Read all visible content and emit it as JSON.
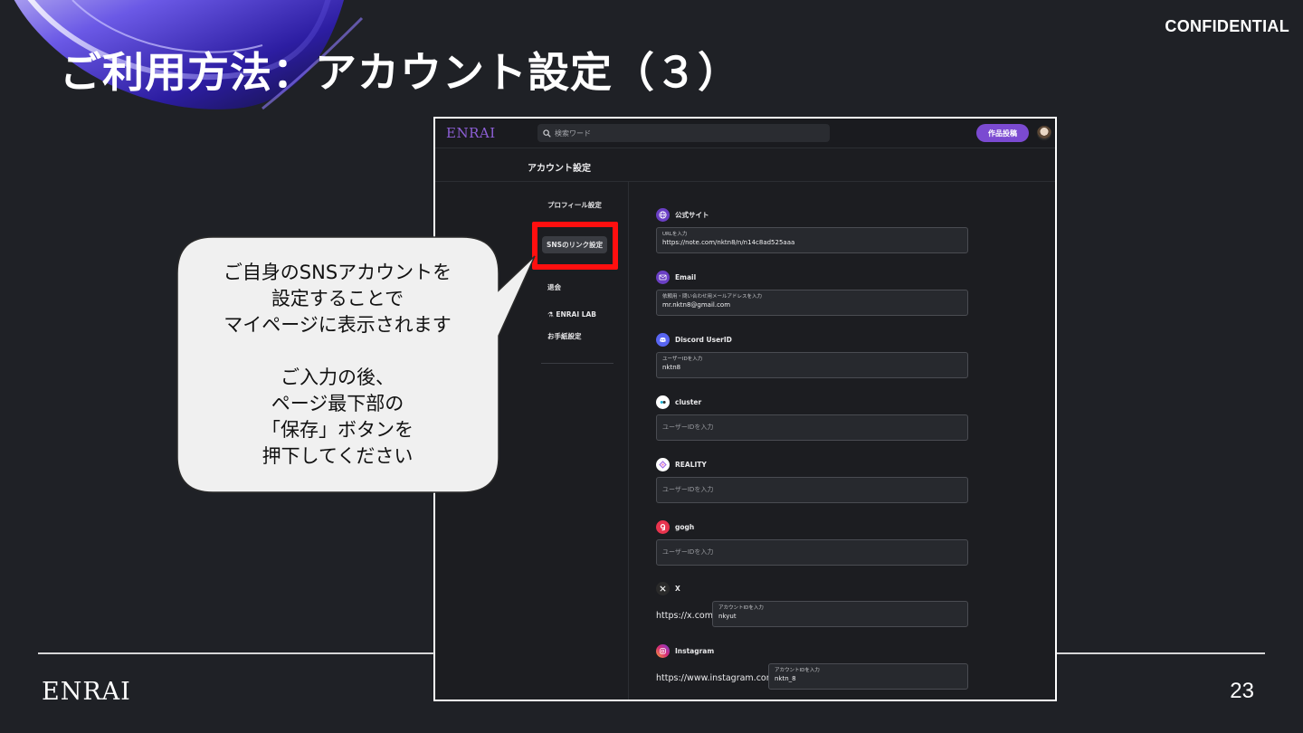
{
  "slide": {
    "confidential": "CONFIDENTIAL",
    "title": "ご利用方法：アカウント設定（３）",
    "footer_logo": "ENRAI",
    "page_number": "23"
  },
  "app": {
    "logo": "ENRAI",
    "search_placeholder": "検索ワード",
    "post_button": "作品投稿",
    "page_title": "アカウント設定",
    "sidebar": {
      "items": [
        "プロフィール設定",
        "SNSのリンク設定",
        "退会",
        "ENRAI LAB",
        "お手紙設定"
      ],
      "active_index": 1
    },
    "sns": [
      {
        "label": "公式サイト",
        "caption": "URLを入力",
        "value": "https://note.com/nktn8/n/n14c8ad525aaa",
        "icon": "globe-icon",
        "color": "#6a3fc4"
      },
      {
        "label": "Email",
        "caption": "依頼用・問い合わせ用メールアドレスを入力",
        "value": "mr.nktn8@gmail.com",
        "icon": "mail-icon",
        "color": "#6a3fc4"
      },
      {
        "label": "Discord UserID",
        "caption": "ユーザーIDを入力",
        "value": "nktn8",
        "icon": "discord-icon",
        "color": "#5865f2"
      },
      {
        "label": "cluster",
        "placeholder": "ユーザーIDを入力",
        "icon": "cluster-icon",
        "color": "#ffffff"
      },
      {
        "label": "REALITY",
        "placeholder": "ユーザーIDを入力",
        "icon": "reality-icon",
        "color": "#ffffff"
      },
      {
        "label": "gogh",
        "placeholder": "ユーザーIDを入力",
        "icon": "gogh-icon",
        "color": "#e8344e"
      },
      {
        "label": "X",
        "prefix": "https://x.com/",
        "caption": "アカウントIDを入力",
        "value": "nkyut",
        "icon": "x-icon",
        "color": "#2a2a2a"
      },
      {
        "label": "Instagram",
        "prefix": "https://www.instagram.com/",
        "caption": "アカウントIDを入力",
        "value": "nktn_8",
        "icon": "instagram-icon",
        "color": "#d62976"
      }
    ]
  },
  "bubble": {
    "lines": [
      "ご自身のSNSアカウントを",
      "設定することで",
      "マイページに表示されます",
      "",
      "ご入力の後、",
      "ページ最下部の",
      "「保存」ボタンを",
      "押下してください"
    ]
  },
  "colors": {
    "background": "#1f2126",
    "accent": "#7b4ad1",
    "highlight": "#ff0f0f"
  }
}
